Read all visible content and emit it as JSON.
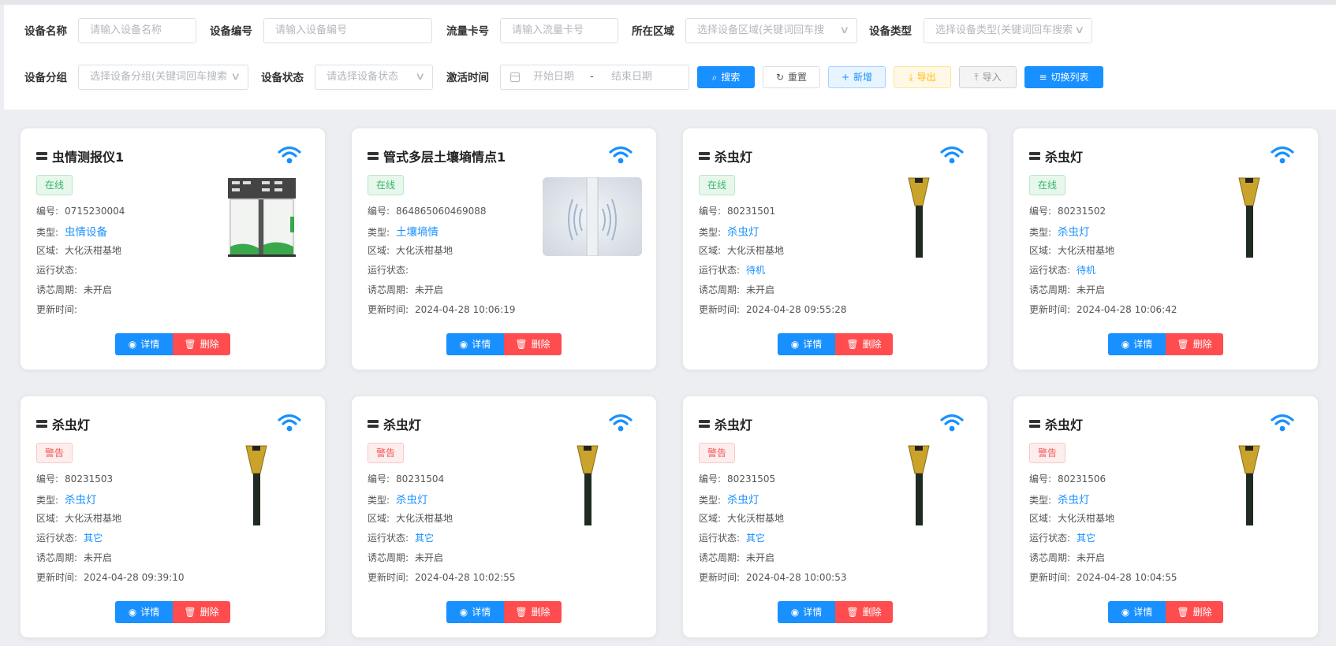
{
  "filters": {
    "name": {
      "label": "设备名称",
      "placeholder": "请输入设备名称"
    },
    "code": {
      "label": "设备编号",
      "placeholder": "请输入设备编号"
    },
    "card": {
      "label": "流量卡号",
      "placeholder": "请输入流量卡号"
    },
    "area": {
      "label": "所在区域",
      "placeholder": "选择设备区域(关键词回车搜"
    },
    "type": {
      "label": "设备类型",
      "placeholder": "选择设备类型(关键词回车搜索"
    },
    "group": {
      "label": "设备分组",
      "placeholder": "选择设备分组(关键词回车搜索"
    },
    "status": {
      "label": "设备状态",
      "placeholder": "请选择设备状态"
    },
    "activation": {
      "label": "激活时间",
      "start_placeholder": "开始日期",
      "separator": "-",
      "end_placeholder": "结束日期"
    }
  },
  "toolbar": {
    "search": "搜索",
    "reset": "重置",
    "add": "新增",
    "export": "导出",
    "import": "导入",
    "switch": "切换列表"
  },
  "field_labels": {
    "code": "编号:",
    "type": "类型:",
    "area": "区域:",
    "run": "运行状态:",
    "cycle": "诱芯周期:",
    "updated": "更新时间:"
  },
  "card_actions": {
    "detail": "详情",
    "delete": "删除"
  },
  "colors": {
    "primary": "#1890ff",
    "danger": "#ff4d4f",
    "online": "#35b86a",
    "warn": "#f25757"
  },
  "devices": [
    {
      "title": "虫情测报仪1",
      "status": "在线",
      "code": "0715230004",
      "type": "虫情设备",
      "area": "大化沃柑基地",
      "run": "",
      "cycle": "未开启",
      "updated": "",
      "image": "pest-monitor-image"
    },
    {
      "title": "管式多层土壤墒情点1",
      "status": "在线",
      "code": "864865060469088",
      "type": "土壤墒情",
      "area": "大化沃柑基地",
      "run": "",
      "cycle": "未开启",
      "updated": "2024-04-28 10:06:19",
      "image": "soil-sensor-image"
    },
    {
      "title": "杀虫灯",
      "status": "在线",
      "code": "80231501",
      "type": "杀虫灯",
      "area": "大化沃柑基地",
      "run": "待机",
      "cycle": "未开启",
      "updated": "2024-04-28 09:55:28",
      "image": "insect-lamp-image"
    },
    {
      "title": "杀虫灯",
      "status": "在线",
      "code": "80231502",
      "type": "杀虫灯",
      "area": "大化沃柑基地",
      "run": "待机",
      "cycle": "未开启",
      "updated": "2024-04-28 10:06:42",
      "image": "insect-lamp-image"
    },
    {
      "title": "杀虫灯",
      "status": "警告",
      "code": "80231503",
      "type": "杀虫灯",
      "area": "大化沃柑基地",
      "run": "其它",
      "cycle": "未开启",
      "updated": "2024-04-28 09:39:10",
      "image": "insect-lamp-image"
    },
    {
      "title": "杀虫灯",
      "status": "警告",
      "code": "80231504",
      "type": "杀虫灯",
      "area": "大化沃柑基地",
      "run": "其它",
      "cycle": "未开启",
      "updated": "2024-04-28 10:02:55",
      "image": "insect-lamp-image"
    },
    {
      "title": "杀虫灯",
      "status": "警告",
      "code": "80231505",
      "type": "杀虫灯",
      "area": "大化沃柑基地",
      "run": "其它",
      "cycle": "未开启",
      "updated": "2024-04-28 10:00:53",
      "image": "insect-lamp-image"
    },
    {
      "title": "杀虫灯",
      "status": "警告",
      "code": "80231506",
      "type": "杀虫灯",
      "area": "大化沃柑基地",
      "run": "其它",
      "cycle": "未开启",
      "updated": "2024-04-28 10:04:55",
      "image": "insect-lamp-image"
    }
  ]
}
